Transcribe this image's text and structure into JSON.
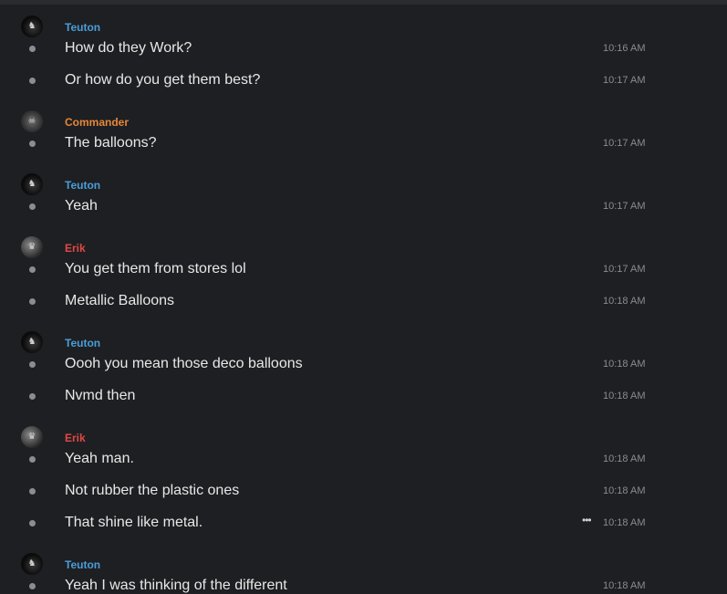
{
  "colors": {
    "background": "#1e1f22",
    "teuton": "#4a9eda",
    "commander": "#e5873a",
    "erik": "#e04848",
    "timestamp": "#8a8c90",
    "bullet": "#8b8d92"
  },
  "messages": [
    {
      "author": "Teuton",
      "text": "How do they Work?",
      "time": "10:16 AM"
    },
    {
      "text": "Or how do you get them best?",
      "time": "10:17 AM"
    },
    {
      "author": "Commander",
      "text": "The balloons?",
      "time": "10:17 AM"
    },
    {
      "author": "Teuton",
      "text": "Yeah",
      "time": "10:17 AM"
    },
    {
      "author": "Erik",
      "text": "You get them from stores lol",
      "time": "10:17 AM"
    },
    {
      "text": "Metallic Balloons",
      "time": "10:18 AM"
    },
    {
      "author": "Teuton",
      "text": "Oooh you mean those deco balloons",
      "time": "10:18 AM"
    },
    {
      "text": "Nvmd then",
      "time": "10:18 AM"
    },
    {
      "author": "Erik",
      "text": "Yeah man.",
      "time": "10:18 AM"
    },
    {
      "text": "Not rubber the plastic ones",
      "time": "10:18 AM"
    },
    {
      "text": "That shine like metal.",
      "time": "10:18 AM",
      "more_icon": "ellipsis-icon"
    },
    {
      "author": "Teuton",
      "text": "Yeah I was thinking of the different",
      "time": "10:18 AM"
    }
  ]
}
